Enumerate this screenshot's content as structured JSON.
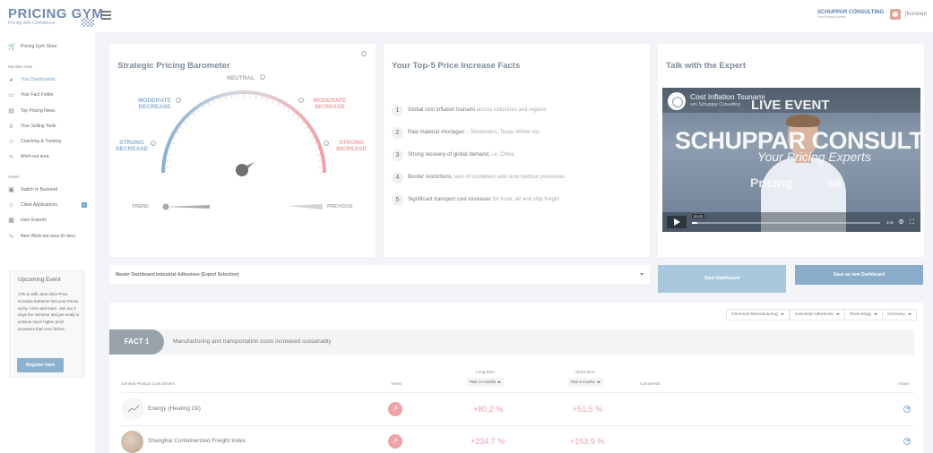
{
  "header": {
    "logo_title": "PRICING GYM",
    "logo_subtitle": "Pricing with Confidence",
    "brand": "SCHUPPAR CONSULTING",
    "brand_sub": "Your Pricing Experts",
    "user": "jfconcept"
  },
  "sidebar": {
    "store": "Pricing Gym Store",
    "member_section": "Member Area",
    "member_items": [
      {
        "label": "Your Dashboards",
        "icon": "dashboard-icon"
      },
      {
        "label": "Your Fact Folder",
        "icon": "book-icon"
      },
      {
        "label": "Top Pricing News",
        "icon": "news-icon"
      },
      {
        "label": "Your Selling Tools",
        "icon": "trophy-icon"
      },
      {
        "label": "Coaching & Training",
        "icon": "person-icon"
      },
      {
        "label": "Work-out area",
        "icon": "activity-icon"
      }
    ],
    "admin_section": "Admin",
    "admin_items": [
      {
        "label": "Switch to Backend",
        "icon": "switch-icon"
      },
      {
        "label": "Client Applications",
        "icon": "clients-icon",
        "badge": "0"
      },
      {
        "label": "User Exports",
        "icon": "export-icon"
      },
      {
        "label": "New Work-out area (in dev)",
        "icon": "activity-icon"
      }
    ],
    "event": {
      "title": "Upcoming Event",
      "text": "17th & 18th June 2021 Price Increase Extreme! Get your Prices up by +41% and more. Join our 2 Days live Seminar and get ready to achieve much higher price increases than ever before.",
      "button": "Register here"
    }
  },
  "barometer": {
    "title": "Strategic Pricing Barometer",
    "neutral": "NEUTRAL",
    "moderate_decrease": "MODERATE DECREASE",
    "moderate_increase": "MODERATE INCREASE",
    "strong_decrease": "STRONG DECREASE",
    "strong_increase": "STRONG INCREASE",
    "trend": "TREND",
    "previous": "PREVIOUS",
    "needle_level": 0.58
  },
  "facts": {
    "title": "Your Top-5 Price Increase Facts",
    "items": [
      {
        "num": "1",
        "bold": "Global cost inflation tsunami",
        "rest": " across industries and regions"
      },
      {
        "num": "2",
        "bold": "Raw material shortages",
        "rest": " – Shutdowns, Texas Winter etc."
      },
      {
        "num": "3",
        "bold": "Strong recovery of global demand,",
        "rest": " i.e. China"
      },
      {
        "num": "4",
        "bold": "Border restrictions,",
        "rest": " lack of containers and slow harbour processes"
      },
      {
        "num": "5",
        "bold": "Significant transport cost increases",
        "rest": " for truck, air and ship freight"
      }
    ]
  },
  "expert": {
    "title": "Talk with the Expert",
    "video_title": "Cost Inflation Tsunami",
    "video_channel": "von Schuppar Consulting",
    "live_badge": "LIVE EVENT",
    "overlay_big": "SCHUPPAR CONSULTING",
    "overlay_tag": "Your Pricing Experts",
    "overlay_sem1": "Pricing",
    "overlay_sem2": "se",
    "time": "02:22",
    "duration": "4:06",
    "progress": 0.03
  },
  "dashboard_select": {
    "value": "Master Dashboard Industrial Adhesives (Expert Selection)"
  },
  "buttons": {
    "save": "Save Dashboard",
    "save_new": "Save as new Dashboard"
  },
  "filters": [
    "Chemical Manufacturing",
    "Industrial Adhesives",
    "Technology",
    "Germany"
  ],
  "fact_band": {
    "pill": "FACT 1",
    "text": "Manufacturing and transportation costs increased sustainably"
  },
  "table": {
    "col_driver": "General Product Cost Drivers",
    "col_trend": "Trend",
    "col_long": "Long-term",
    "col_short": "Short-term",
    "period_long": "Past 12 months",
    "period_short": "Past 6 months",
    "col_comments": "Comments",
    "col_action": "Action",
    "rows": [
      {
        "name": "Energy (Heating Oil)",
        "long": "+80,2 %",
        "short": "+51,5 %",
        "icon": "trend-icon"
      },
      {
        "name": "Shanghai Containerized Freight Index",
        "long": "+234,7 %",
        "short": "+153,9 %",
        "icon": "freight-photo"
      }
    ]
  }
}
